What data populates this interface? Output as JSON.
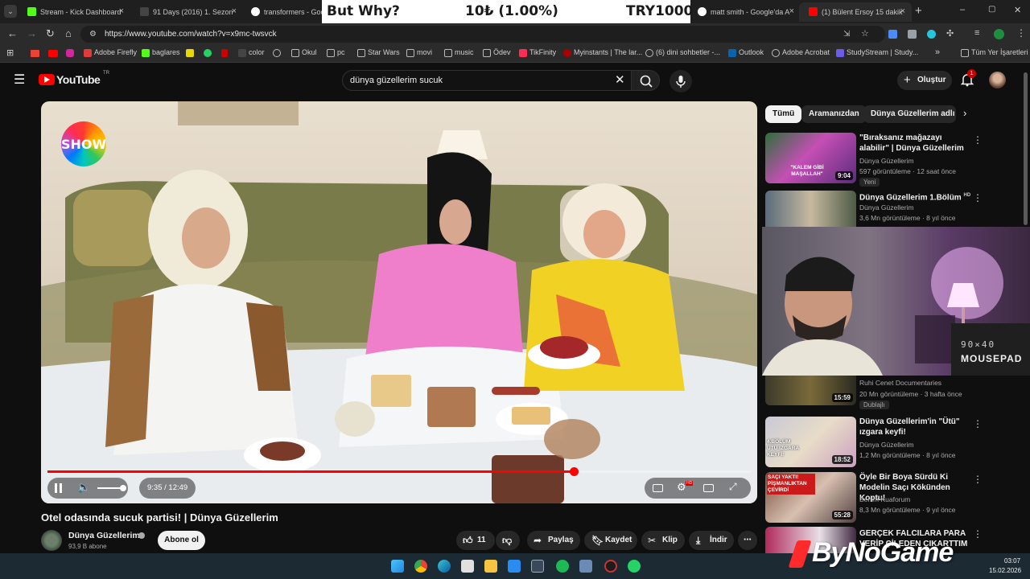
{
  "browser": {
    "tabs": [
      {
        "label": "Stream - Kick Dashboard",
        "close": "×"
      },
      {
        "label": "91 Days (2016) 1. Sezon",
        "close": "×"
      },
      {
        "label": "transformers - Googl",
        "close": ""
      },
      {
        "label": "matt smith - Google'da A",
        "close": "×"
      },
      {
        "label": "(1) Bülent Ersoy 15 dakik",
        "close": "×"
      }
    ],
    "new_tab": "+",
    "window_controls": [
      "–",
      "▢",
      "✕"
    ],
    "url": "https://www.youtube.com/watch?v=x9mc-twsvck",
    "bookmarks": [
      "Adobe Firefly",
      "baglares",
      "color",
      "Okul",
      "pc",
      "Star Wars",
      "movi",
      "music",
      "Ödev",
      "TikFinity",
      "Myinstants | The lar...",
      "(6) dini sohbetler -...",
      "Outlook",
      "Adobe Acrobat",
      "StudyStream | Study..."
    ],
    "bookmarks_overflow": "»",
    "all_bookmarks": "Tüm Yer İşaretleri"
  },
  "overlay_banner": {
    "left": "But Why?",
    "center": "10₺ (1.00%)",
    "right": "TRY1000"
  },
  "youtube": {
    "logo": "YouTube",
    "logo_region": "TR",
    "search_query": "dünya güzellerim sucuk",
    "create_label": "Oluştur",
    "notification_count": "1",
    "player": {
      "channel_logo": "SHOW",
      "time": "9:35 / 12:49",
      "progress": 0.748
    },
    "video_title": "Otel odasında sucuk partisi! | Dünya Güzellerim",
    "channel": {
      "name": "Dünya Güzellerim",
      "subscribers": "93,9 B abone",
      "subscribe_label": "Abone ol"
    },
    "actions": {
      "likes": "11",
      "share": "Paylaş",
      "save": "Kaydet",
      "clip": "Klip",
      "download": "İndir"
    },
    "chips": [
      "Tümü",
      "Aramanızdan",
      "Dünya Güzellerim adlı yü"
    ],
    "recommendations": [
      {
        "title": "\"Bıraksanız mağazayı alabilir\" | Dünya Güzellerim",
        "channel": "Dünya Güzellerim",
        "meta": "597 görüntüleme · 12 saat önce",
        "badge": "Yeni",
        "duration": "9:04",
        "thumb_text": "\"KALEM GİBİ MAŞALLAH\""
      },
      {
        "title": "Dünya Güzellerim 1.Bölüm",
        "hd": "HD",
        "channel": "Dünya Güzellerim",
        "meta": "3,6 Mn görüntüleme · 8 yıl önce",
        "badge": "",
        "duration": "",
        "thumb_text": ""
      },
      {
        "title": "",
        "channel": "Ruhi Cenet Documentaries",
        "meta": "20 Mn görüntüleme · 3 hafta önce",
        "badge": "Dublajlı",
        "duration": "15:59",
        "thumb_text": ""
      },
      {
        "title": "Dünya Güzellerim'in \"Ütü\" ızgara keyfi!",
        "channel": "Dünya Güzellerim",
        "meta": "1,2 Mn görüntüleme · 8 yıl önce",
        "badge": "",
        "duration": "18:52",
        "thumb_text": "4.BÖLÜM ÜTÜ IZGARA KEYFİ!"
      },
      {
        "title": "Öyle Bir Boya Sürdü Ki Modelin Saçı Kökünden Koptu!",
        "channel": "Benim Kuaforum",
        "meta": "8,3 Mn görüntüleme · 9 yıl önce",
        "badge": "",
        "duration": "55:28",
        "thumb_text": "SAÇI YAKTI! PİŞMANLIKTAN ÇEVİRDİ"
      },
      {
        "title": "GERÇEK FALCILARA PARA VERİP ÇİLEDEN ÇIKARTTIM ...",
        "channel": "",
        "meta": "",
        "badge": "",
        "duration": "",
        "thumb_text": ""
      }
    ]
  },
  "webcam": {
    "wall_text_1": "90×40",
    "wall_text_2": "MOUSEPAD"
  },
  "watermark": "ByNoGame",
  "taskbar": {
    "time": "03:07",
    "date": "15.02.2026"
  },
  "colors": {
    "yt_red": "#ff0000",
    "bg": "#0f0f0f",
    "chip_bg": "#272727"
  }
}
